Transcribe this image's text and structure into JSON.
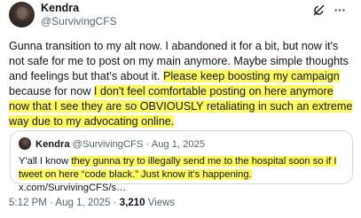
{
  "author": {
    "name": "Kendra",
    "handle": "@SurvivingCFS"
  },
  "icons": [
    "grok-icon",
    "more-icon"
  ],
  "post": {
    "text_plain_1": "Gunna transition to my alt now. I abandoned it for a bit, but now it's not safe for me to post on my main anymore. Maybe simple thoughts and feelings but that's about it. ",
    "text_hl_1": "Please keep boosting my campaign",
    "text_plain_2": " because for now ",
    "text_hl_2": "I don't feel comfortable posting on here anymore now that I see they are so OBVIOUSLY retaliating in such an extreme way due to my advocating online."
  },
  "quote": {
    "name": "Kendra",
    "handle": "@SurvivingCFS",
    "date": "Aug 1, 2025",
    "text_plain_1": "Y'all I know ",
    "text_hl_1": "they gunna try to illegally send me to the hospital soon so if I tweet on here “code black.” Just know it's happening.",
    "text_plain_2": " x.com/SurvivingCFS/s…"
  },
  "footer": {
    "time": "5:12 PM",
    "date": "Aug 1, 2025",
    "views_count": "3,210",
    "views_label": "Views"
  },
  "colors": {
    "highlight": "#fff95e",
    "muted": "#536471",
    "border": "#cfd9de"
  }
}
